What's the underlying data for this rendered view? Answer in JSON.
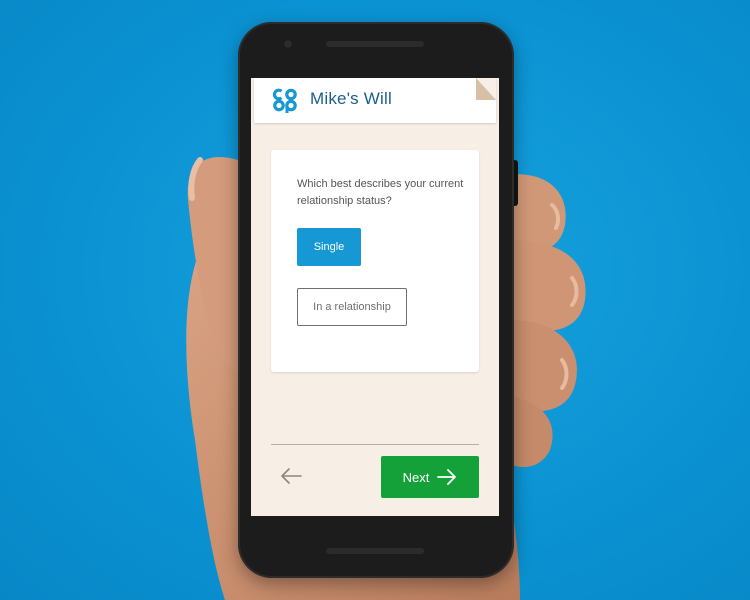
{
  "app": {
    "title": "Mike's Will",
    "logo": "coop-logo",
    "brand_color": "#1598d3",
    "title_color": "#1d5f8a"
  },
  "question": {
    "text": "Which best describes your current relationship status?"
  },
  "options": [
    {
      "label": "Single",
      "selected": true
    },
    {
      "label": "In a relationship",
      "selected": false
    }
  ],
  "navigation": {
    "back_icon": "arrow-left-icon",
    "next_label": "Next",
    "next_icon": "arrow-right-icon",
    "next_color": "#15a13a"
  }
}
